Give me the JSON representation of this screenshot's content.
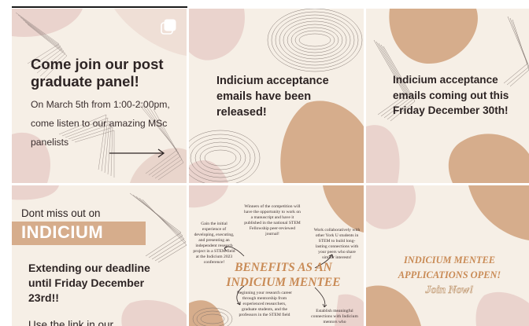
{
  "posts": [
    {
      "title": "Come join our post graduate panel!",
      "body": "On March 5th from 1:00-2:00pm, come listen to our amazing MSc panelists"
    },
    {
      "title": "Indicium acceptance emails have been released!"
    },
    {
      "title": "Indicium acceptance emails coming out this Friday December 30th!"
    },
    {
      "lead": "Dont miss out on",
      "brand": "INDICIUM",
      "sub": "Extending our deadline until Friday December 23rd!!",
      "tail": "Use the link in our"
    },
    {
      "heading": "BENEFITS AS AN INDICIUM MENTEE",
      "notes": [
        "Winners of the competition will have the opportunity to work on a manuscript and have it published in the national STEM Fellowship peer-reviewed journal!",
        "Gain the initial experience of developing, executing, and presenting an independent research project in a STEM field at the Indicium 2023 conference!",
        "Work collaboratively with other York U students in STEM to build long-lasting connections with your peers who share similar interests!",
        "Beginning your research career through mentorship from experienced researchers, graduate students, and the professors in the STEM field",
        "Establish meaningful connections with Indicium mentors who"
      ]
    },
    {
      "heading": "INDICIUM MENTEE APPLICATIONS OPEN!",
      "join": "Join Now!"
    }
  ],
  "colors": {
    "cream": "#f6efe6",
    "tan": "#d6ad8c",
    "blush": "#ead3cd",
    "text": "#2d2424",
    "accent": "#c98b56"
  }
}
